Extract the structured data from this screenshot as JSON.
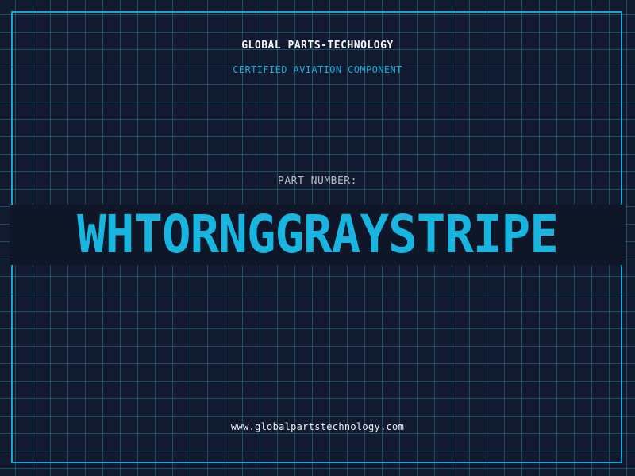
{
  "header": {
    "company": "GLOBAL PARTS-TECHNOLOGY",
    "subtitle": "CERTIFIED AVIATION COMPONENT"
  },
  "part": {
    "label": "PART NUMBER:",
    "number": "WHTORNGGRAYSTRIPE"
  },
  "footer": {
    "website": "www.globalpartstechnology.com"
  },
  "colors": {
    "background": "#111a2f",
    "grid": "#28789a",
    "accent": "#1aa3cf",
    "text_primary": "#f2f5f7",
    "text_muted": "#b4bcc8"
  }
}
